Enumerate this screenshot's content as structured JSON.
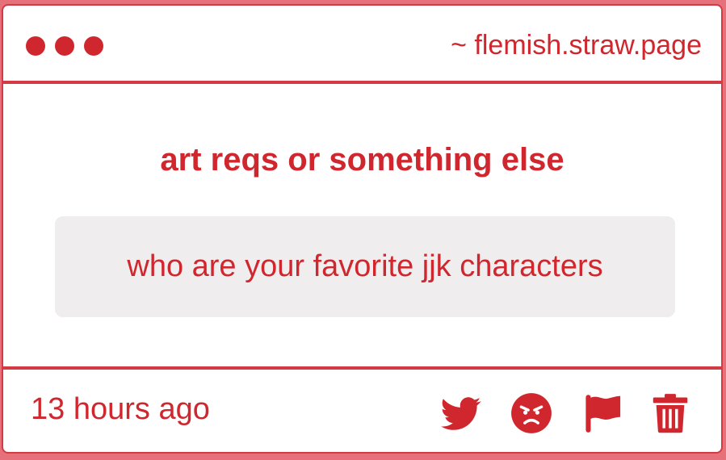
{
  "header": {
    "window_dots": [
      "red-dot",
      "red-dot",
      "red-dot"
    ],
    "url": "~ flemish.straw.page"
  },
  "main": {
    "title": "art reqs or something else",
    "message": "who are your favorite jjk characters"
  },
  "footer": {
    "timestamp": "13 hours ago",
    "actions": [
      {
        "icon": "twitter-icon",
        "label": "Share to Twitter"
      },
      {
        "icon": "angry-face-icon",
        "label": "Angry"
      },
      {
        "icon": "flag-icon",
        "label": "Report"
      },
      {
        "icon": "trash-icon",
        "label": "Delete"
      }
    ]
  },
  "colors": {
    "accent": "#d0262e",
    "border": "#d33b44",
    "message_bg": "#efeded",
    "page_bg": "#e7717a"
  }
}
